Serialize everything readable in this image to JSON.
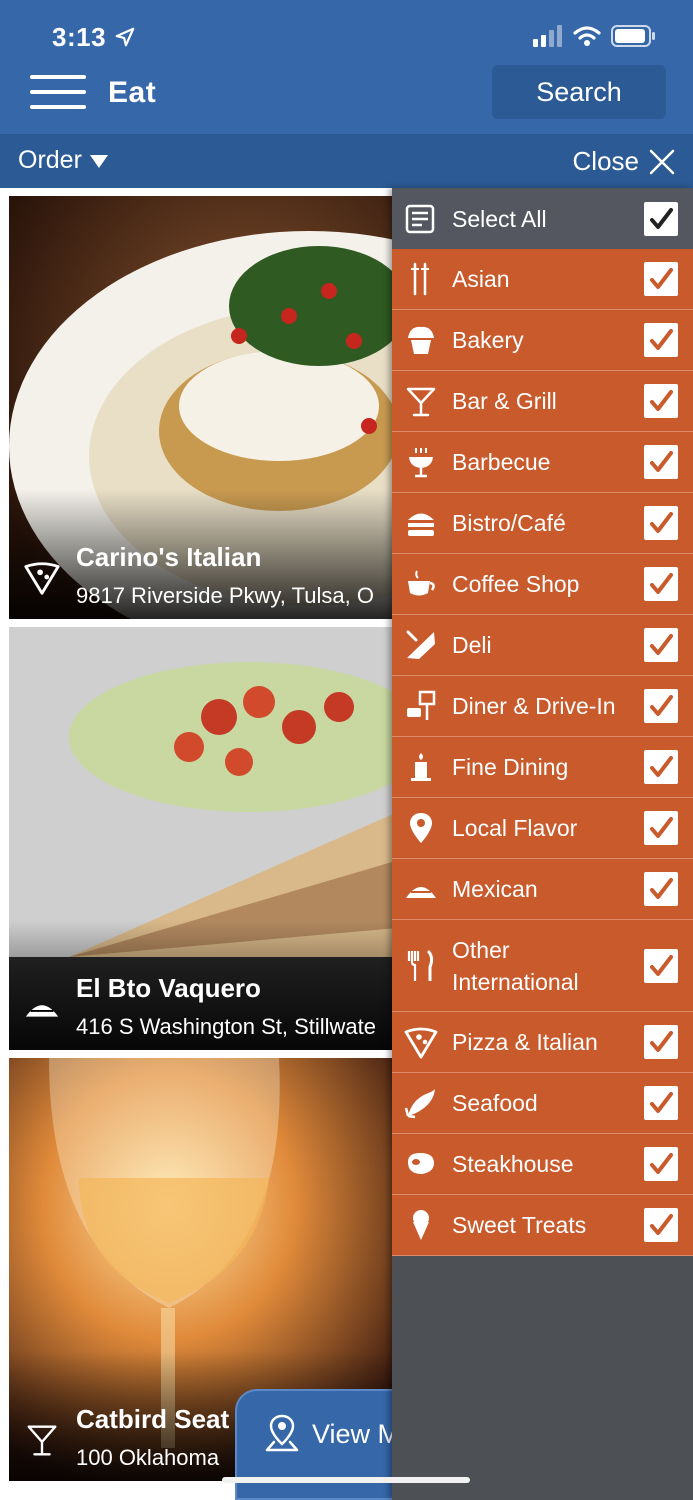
{
  "status": {
    "time": "3:13"
  },
  "nav": {
    "title": "Eat",
    "search_label": "Search"
  },
  "subbar": {
    "order_label": "Order",
    "close_label": "Close"
  },
  "cards": [
    {
      "name": "Carino's Italian",
      "address": "9817 Riverside Pkwy, Tulsa, O",
      "icon": "pizza-icon"
    },
    {
      "name": "El Bto Vaquero",
      "address": "416 S Washington St, Stillwate",
      "icon": "taco-icon"
    },
    {
      "name": "Catbird Seat",
      "address": "100 Oklahoma",
      "icon": "cocktail-icon"
    }
  ],
  "view_map": {
    "label": "View M"
  },
  "filters": {
    "select_all_label": "Select All",
    "items": [
      {
        "label": "Asian",
        "icon": "chopsticks-icon",
        "checked": true
      },
      {
        "label": "Bakery",
        "icon": "cupcake-icon",
        "checked": true
      },
      {
        "label": "Bar & Grill",
        "icon": "cocktail-icon",
        "checked": true
      },
      {
        "label": "Barbecue",
        "icon": "grill-icon",
        "checked": true
      },
      {
        "label": "Bistro/Café",
        "icon": "burger-icon",
        "checked": true
      },
      {
        "label": "Coffee Shop",
        "icon": "coffee-cup-icon",
        "checked": true
      },
      {
        "label": "Deli",
        "icon": "sandwich-icon",
        "checked": true
      },
      {
        "label": "Diner & Drive-In",
        "icon": "drive-in-icon",
        "checked": true
      },
      {
        "label": "Fine Dining",
        "icon": "candle-icon",
        "checked": true
      },
      {
        "label": "Local Flavor",
        "icon": "map-pin-icon",
        "checked": true
      },
      {
        "label": "Mexican",
        "icon": "taco-icon",
        "checked": true
      },
      {
        "label": "Other\nInternational",
        "icon": "fork-knife-icon",
        "checked": true
      },
      {
        "label": "Pizza & Italian",
        "icon": "pizza-icon",
        "checked": true
      },
      {
        "label": "Seafood",
        "icon": "fish-icon",
        "checked": true
      },
      {
        "label": "Steakhouse",
        "icon": "steak-icon",
        "checked": true
      },
      {
        "label": "Sweet Treats",
        "icon": "ice-cream-icon",
        "checked": true
      }
    ]
  },
  "colors": {
    "header_blue": "#3567a9",
    "subbar_blue": "#2c5a95",
    "filter_orange": "#c85a2c",
    "panel_gray": "#4d5055"
  }
}
